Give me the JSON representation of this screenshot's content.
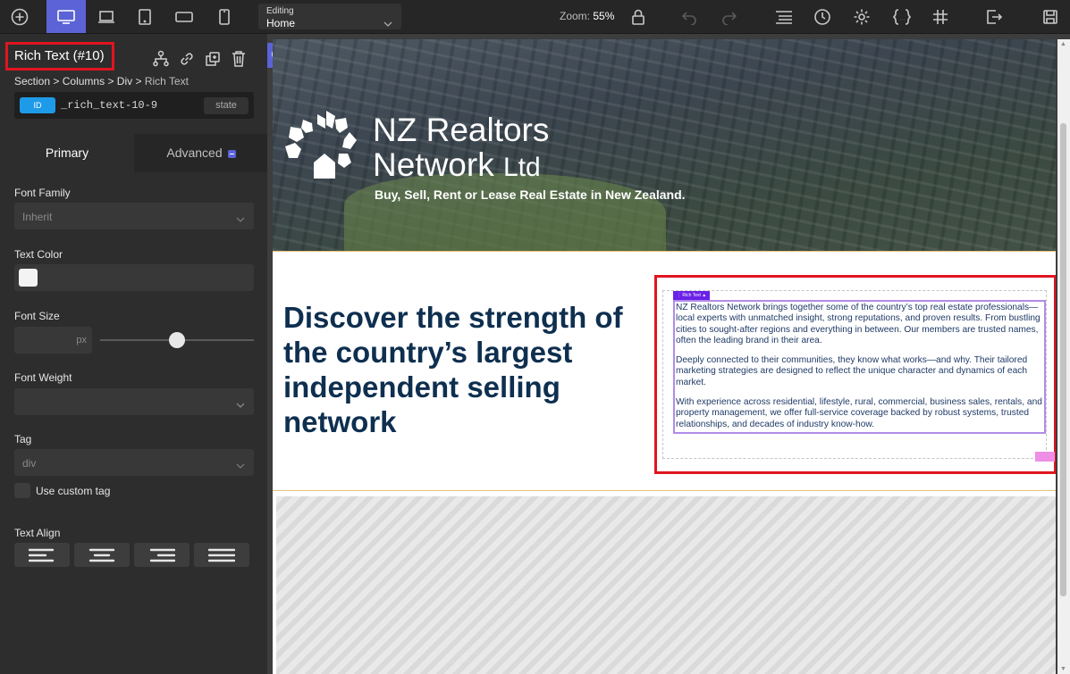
{
  "topbar": {
    "editing_label": "Editing",
    "editing_value": "Home",
    "zoom_label": "Zoom:",
    "zoom_value": "55%"
  },
  "panel": {
    "selected_title": "Rich Text (#10)",
    "breadcrumb": {
      "items": [
        "Section",
        "Columns",
        "Div"
      ],
      "current": "Rich Text",
      "separator": ">"
    },
    "id_badge": "ID",
    "id_value": "_rich_text-10-9",
    "state_button": "state",
    "tabs": {
      "primary": "Primary",
      "advanced": "Advanced"
    },
    "font_family": {
      "label": "Font Family",
      "value": "Inherit"
    },
    "text_color": {
      "label": "Text Color",
      "swatch": "#f3f3f3"
    },
    "font_size": {
      "label": "Font Size",
      "unit": "px"
    },
    "font_weight": {
      "label": "Font Weight",
      "value": ""
    },
    "tag": {
      "label": "Tag",
      "value": "div"
    },
    "custom_tag": {
      "label": "Use custom tag",
      "checked": false
    },
    "text_align": {
      "label": "Text Align",
      "options": [
        "left",
        "center",
        "right",
        "justify"
      ]
    }
  },
  "canvas": {
    "hero": {
      "logo_line1": "NZ Realtors",
      "logo_line2": "Network",
      "logo_ltd": "Ltd",
      "tagline": "Buy, Sell, Rent or Lease Real Estate in New Zealand."
    },
    "headline": "Discover the strength of the country’s largest independent selling network",
    "rich_text_tag": "Rich Text",
    "paragraphs": [
      "NZ Realtors Network brings together some of the country’s top real estate professionals—local experts with unmatched insight, strong reputations, and proven results. From bustling cities to sought-after regions and everything in between. Our members are trusted names, often the leading brand in their area.",
      "Deeply connected to their communities, they know what works—and why. Their tailored marketing strategies are designed to reflect the unique character and dynamics of each market.",
      "With experience across residential, lifestyle, rural, commercial, business sales, rentals, and property management, we offer full-service coverage backed by robust systems, trusted relationships, and decades of industry know-how."
    ]
  },
  "colors": {
    "accent": "#5b63d6",
    "selection_red": "#e0151f",
    "headline_navy": "#0e2f4f",
    "rich_text_purple": "#6b21e8"
  }
}
